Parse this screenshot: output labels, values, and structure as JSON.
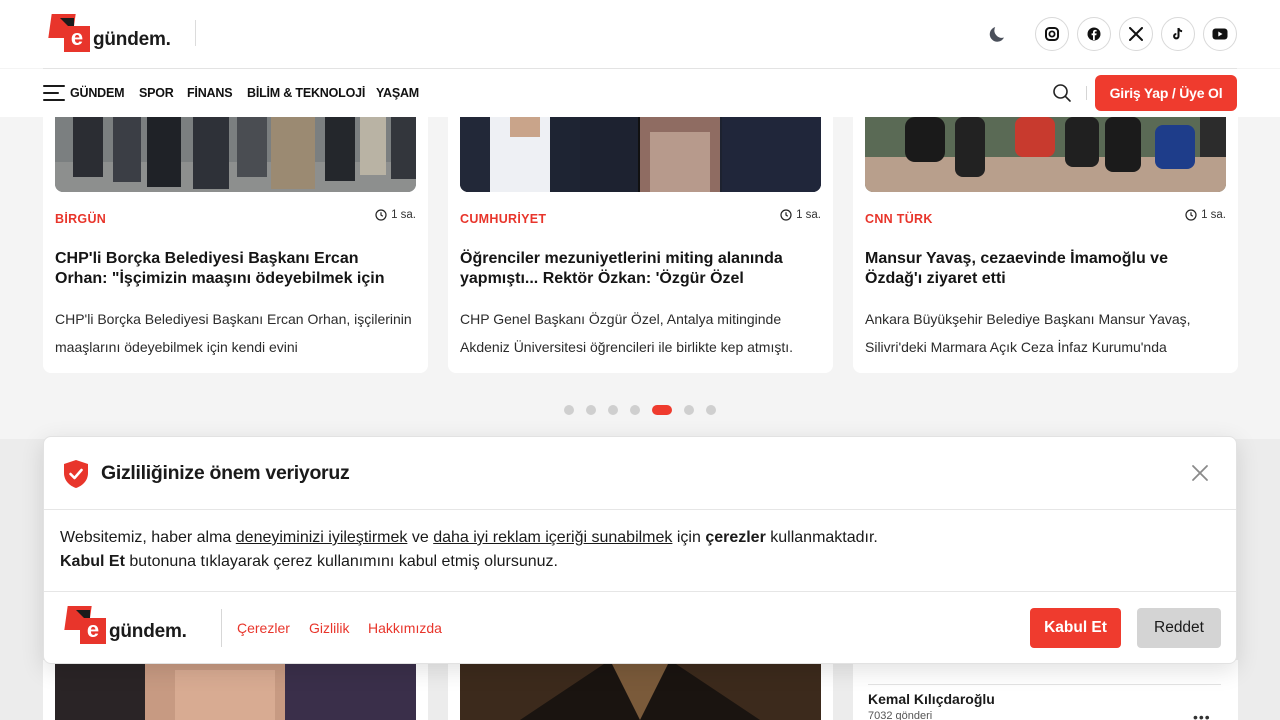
{
  "brand": {
    "logo_letter": "e",
    "logo_text": "gündem.",
    "accent": "#ef3b2e"
  },
  "header": {
    "social": [
      {
        "icon": "instagram-icon",
        "label": "Instagram"
      },
      {
        "icon": "facebook-icon",
        "label": "Facebook"
      },
      {
        "icon": "x-icon",
        "label": "X"
      },
      {
        "icon": "tiktok-icon",
        "label": "TikTok"
      },
      {
        "icon": "youtube-icon",
        "label": "YouTube"
      }
    ],
    "nav": [
      "GÜNDEM",
      "SPOR",
      "FİNANS",
      "BİLİM & TEKNOLOJİ",
      "YAŞAM"
    ],
    "login_label": "Giriş Yap / Üye Ol"
  },
  "cards": [
    {
      "source": "BİRGÜN",
      "time": "1 sa.",
      "title": "CHP'li Borçka Belediyesi Başkanı Ercan Orhan: \"İşçimizin maaşını ödeyebilmek için",
      "desc": "CHP'li Borçka Belediyesi Başkanı Ercan Orhan, işçilerinin maaşlarını ödeyebilmek için kendi evini"
    },
    {
      "source": "CUMHURİYET",
      "time": "1 sa.",
      "title": "Öğrenciler mezuniyetlerini miting alanında yapmıştı... Rektör Özkan: 'Özgür Özel",
      "desc": "CHP Genel Başkanı Özgür Özel, Antalya mitinginde Akdeniz Üniversitesi öğrencileri ile birlikte kep atmıştı."
    },
    {
      "source": "CNN TÜRK",
      "time": "1 sa.",
      "title": "Mansur Yavaş, cezaevinde İmamoğlu ve Özdağ'ı ziyaret etti",
      "desc": "Ankara Büyükşehir Belediye Başkanı Mansur Yavaş, Silivri'deki Marmara Açık Ceza İnfaz Kurumu'nda"
    }
  ],
  "carousel": {
    "total": 7,
    "active_index": 4
  },
  "trending": {
    "name": "Kemal Kılıçdaroğlu",
    "posts": "7032 gönderi",
    "more": "•••"
  },
  "cookie": {
    "title": "Gizliliğinize önem veriyoruz",
    "body_1": "Websitemiz, haber alma ",
    "link_1": "deneyiminizi iyileştirmek",
    "body_2": " ve ",
    "link_2": "daha iyi reklam içeriği sunabilmek",
    "body_3": " için ",
    "bold_1": "çerezler",
    "body_4": " kullanmaktadır.",
    "bold_2": "Kabul Et",
    "body_5": " butonuna tıklayarak çerez kullanımını kabul etmiş olursunuz.",
    "links": [
      "Çerezler",
      "Gizlilik",
      "Hakkımızda"
    ],
    "accept_label": "Kabul Et",
    "reject_label": "Reddet"
  }
}
